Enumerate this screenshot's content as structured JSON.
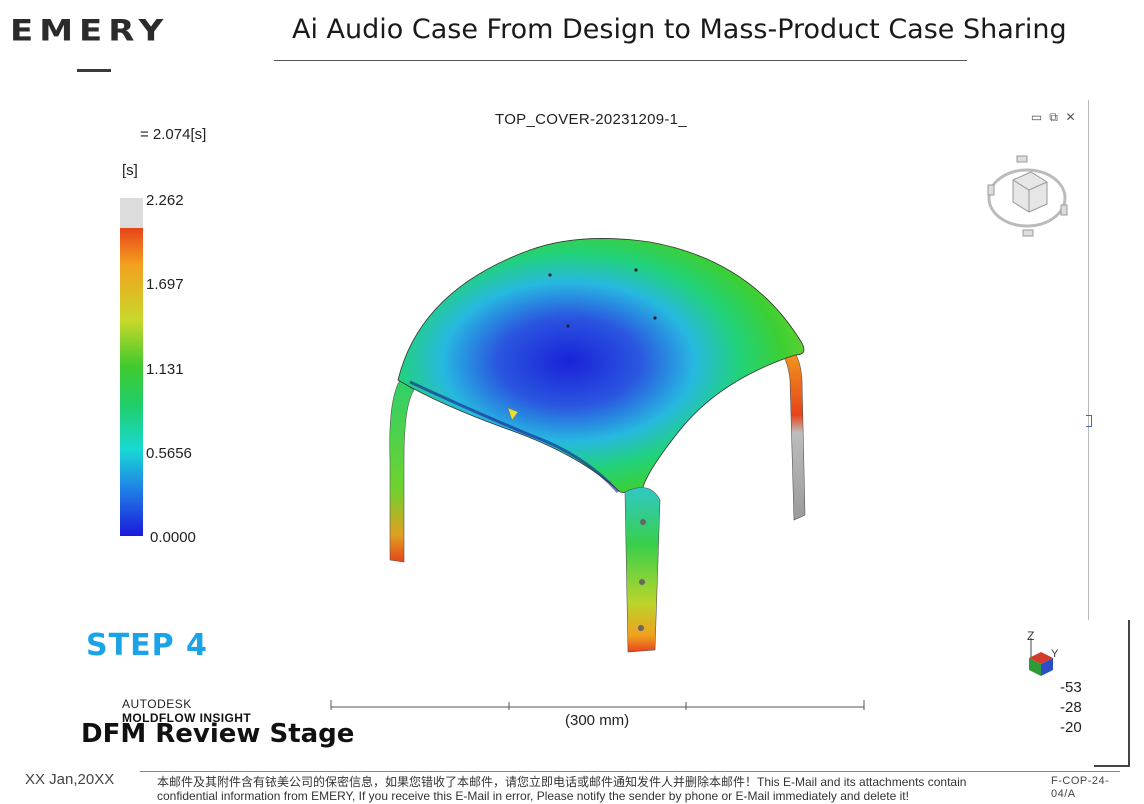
{
  "header": {
    "logo_text": "EMERY",
    "title": "Ai Audio Case From Design to Mass-Product Case Sharing"
  },
  "viewport": {
    "model_title": "TOP_COVER-20231209-1_",
    "time_readout": "= 2.074[s]",
    "unit_label": "[s]",
    "legend": {
      "ticks": [
        "2.262",
        "1.697",
        "1.131",
        "0.5656",
        "0.0000"
      ],
      "colors": [
        "#dcdcdc",
        "#e8441a",
        "#f3a11f",
        "#3fca2e",
        "#19d9d4",
        "#1f7fe6",
        "#1a1adc"
      ]
    },
    "scale_label": "(300 mm)",
    "coords": [
      "-53",
      "-28",
      "-20"
    ],
    "axes_labels": {
      "z": "Z",
      "y": "Y"
    },
    "brand": {
      "line1": "AUTODESK",
      "line2": "MOLDFLOW INSIGHT"
    },
    "window_controls": {
      "minimize": "▭",
      "restore": "⧉",
      "close": "✕"
    }
  },
  "slide": {
    "step": "STEP 4",
    "stage": "DFM Review Stage",
    "accent_color": "#1aa3e8"
  },
  "footer": {
    "date": "XX Jan,20XX",
    "notice_cn": "本邮件及其附件含有铱美公司的保密信息，如果您错收了本邮件，请您立即电话或邮件通知发件人并删除本邮件！This E-Mail and its attachments contain",
    "notice_en": "confidential information from EMERY, If you receive this E-Mail in error, Please notify the sender by phone or E-Mail  immediately and delete it!",
    "code_line1": "F-COP-24-",
    "code_line2": "04/A"
  }
}
